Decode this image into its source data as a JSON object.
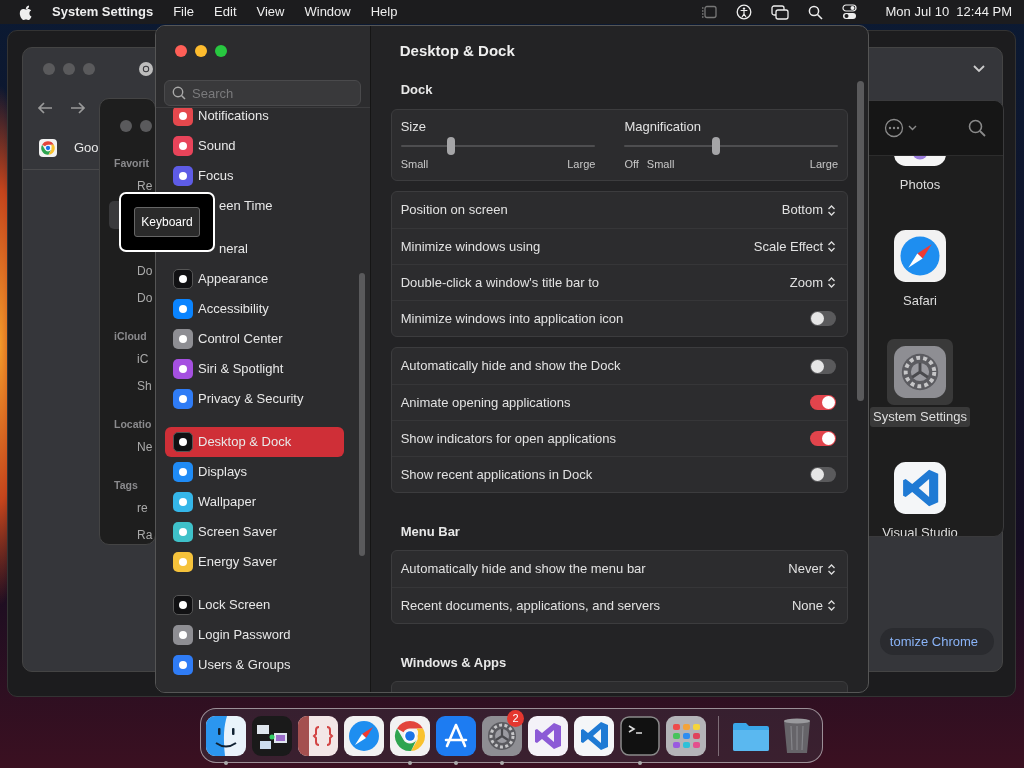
{
  "menu_bar": {
    "app": "System Settings",
    "menus": [
      "File",
      "Edit",
      "View",
      "Window",
      "Help"
    ],
    "clock": "Mon Jul 10  12:44 PM"
  },
  "browser_window": {
    "tab_title": "Goo",
    "button": "tomize Chrome"
  },
  "finder_window": {
    "sections": [
      {
        "heading": "Favorit",
        "items": [
          "Re",
          "Do",
          "Do"
        ]
      },
      {
        "heading": "iCloud",
        "items": [
          "iC",
          "Sh"
        ]
      },
      {
        "heading": "Locatio",
        "items": [
          "Ne"
        ]
      },
      {
        "heading": "Tags",
        "items": [
          "re",
          "Ra"
        ]
      }
    ]
  },
  "apps_window": {
    "apps": [
      {
        "label": "Photos",
        "kind": "photos",
        "selected": false
      },
      {
        "label": "Safari",
        "kind": "safari",
        "selected": false
      },
      {
        "label": "System Settings",
        "kind": "settings",
        "selected": true
      },
      {
        "label": "Visual Studio",
        "kind": "vscode",
        "selected": false
      }
    ]
  },
  "settings": {
    "search": {
      "placeholder": "Search"
    },
    "sidebar": {
      "groups": [
        {
          "items": [
            {
              "label": "Notifications",
              "color": "#e5484d",
              "selected": false
            },
            {
              "label": "Sound",
              "color": "#e8445a",
              "selected": false
            },
            {
              "label": "Focus",
              "color": "#5e5ce6",
              "selected": false
            },
            {
              "label": "een Time",
              "kind": "covered",
              "selected": false
            }
          ]
        },
        {
          "items": [
            {
              "label": "neral",
              "kind": "covered",
              "selected": false
            },
            {
              "label": "Appearance",
              "color": "#111113",
              "selected": false
            },
            {
              "label": "Accessibility",
              "color": "#0a84ff",
              "selected": false
            },
            {
              "label": "Control Center",
              "color": "#8e8e93",
              "selected": false
            },
            {
              "label": "Siri & Spotlight",
              "color": "#a550e0",
              "selected": false
            },
            {
              "label": "Privacy & Security",
              "color": "#2f7cf6",
              "selected": false
            }
          ]
        },
        {
          "items": [
            {
              "label": "Desktop & Dock",
              "color": "#111113",
              "selected": true
            },
            {
              "label": "Displays",
              "color": "#1f8bf5",
              "selected": false
            },
            {
              "label": "Wallpaper",
              "color": "#35b6e8",
              "selected": false
            },
            {
              "label": "Screen Saver",
              "color": "#3fc1c9",
              "selected": false
            },
            {
              "label": "Energy Saver",
              "color": "#f5c23b",
              "selected": false
            }
          ]
        },
        {
          "items": [
            {
              "label": "Lock Screen",
              "color": "#111113",
              "selected": false
            },
            {
              "label": "Login Password",
              "color": "#8e8e93",
              "selected": false
            },
            {
              "label": "Users & Groups",
              "color": "#2f7cf6",
              "selected": false
            }
          ]
        }
      ]
    },
    "title": "Desktop & Dock",
    "sections": [
      {
        "heading": "Dock",
        "cards": [
          {
            "kind": "sliders",
            "sliders": [
              {
                "label": "Size",
                "level": 0.26,
                "ends": [
                  "Small",
                  "Large"
                ]
              },
              {
                "label": "Magnification",
                "level": 0.43,
                "ends": [
                  "Off",
                  "Small",
                  "Large"
                ]
              }
            ]
          },
          {
            "kind": "rows",
            "rows": [
              {
                "label": "Position on screen",
                "kind": "popup",
                "value": "Bottom"
              },
              {
                "label": "Minimize windows using",
                "kind": "popup",
                "value": "Scale Effect"
              },
              {
                "label": "Double-click a window's title bar to",
                "kind": "popup",
                "value": "Zoom"
              },
              {
                "label": "Minimize windows into application icon",
                "kind": "toggle",
                "on": false
              }
            ]
          },
          {
            "kind": "rows",
            "rows": [
              {
                "label": "Automatically hide and show the Dock",
                "kind": "toggle",
                "on": false
              },
              {
                "label": "Animate opening applications",
                "kind": "toggle",
                "on": true
              },
              {
                "label": "Show indicators for open applications",
                "kind": "toggle",
                "on": true
              },
              {
                "label": "Show recent applications in Dock",
                "kind": "toggle",
                "on": false
              }
            ]
          }
        ]
      },
      {
        "heading": "Menu Bar",
        "cards": [
          {
            "kind": "rows",
            "rows": [
              {
                "label": "Automatically hide and show the menu bar",
                "kind": "popup",
                "value": "Never"
              },
              {
                "label": "Recent documents, applications, and servers",
                "kind": "popup",
                "value": "None"
              }
            ]
          }
        ]
      },
      {
        "heading": "Windows & Apps",
        "cards": [
          {
            "kind": "cut"
          }
        ]
      }
    ]
  },
  "tooltip": {
    "label": "Keyboard"
  },
  "dock": {
    "apps": [
      {
        "kind": "finder",
        "running": true
      },
      {
        "kind": "migration",
        "running": false
      },
      {
        "kind": "script",
        "running": false
      },
      {
        "kind": "safari",
        "running": false
      },
      {
        "kind": "chrome",
        "running": true
      },
      {
        "kind": "appstore",
        "running": true
      },
      {
        "kind": "settings",
        "running": true,
        "badge": "2"
      },
      {
        "kind": "vs",
        "running": false
      },
      {
        "kind": "vscode",
        "running": false
      },
      {
        "kind": "terminal",
        "running": true
      },
      {
        "kind": "launchpad",
        "running": false
      },
      {
        "kind": "folder",
        "running": false
      },
      {
        "kind": "trash",
        "running": false
      }
    ]
  }
}
